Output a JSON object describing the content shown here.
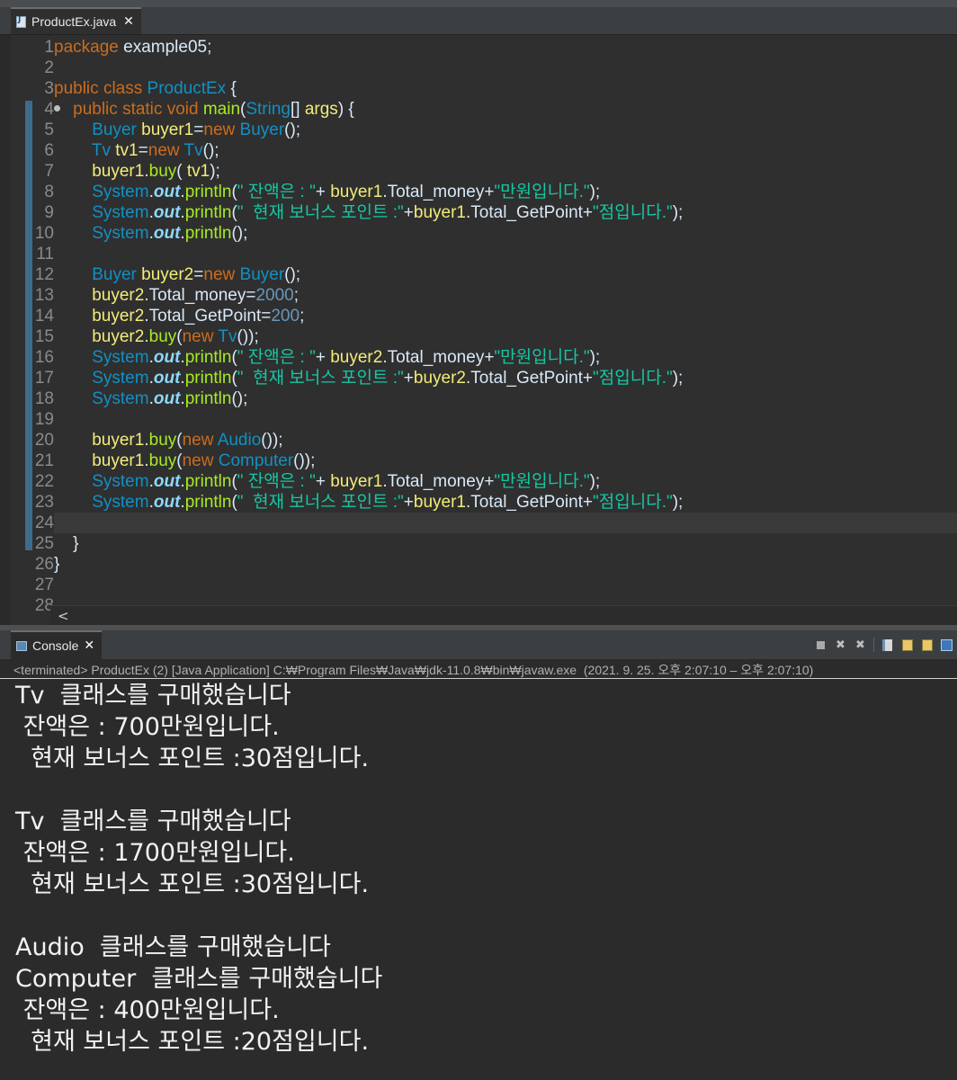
{
  "editor": {
    "tab_title": "ProductEx.java",
    "tab_close": "✕",
    "line_numbers": [
      "1",
      "2",
      "3",
      "4",
      "5",
      "6",
      "7",
      "8",
      "9",
      "10",
      "11",
      "12",
      "13",
      "14",
      "15",
      "16",
      "17",
      "18",
      "19",
      "20",
      "21",
      "22",
      "23",
      "24",
      "25",
      "26",
      "27",
      "28"
    ],
    "lines": [
      "package example05;",
      "",
      "public class ProductEx {",
      "    public static void main(String[] args) {",
      "        Buyer buyer1=new Buyer();",
      "        Tv tv1=new Tv();",
      "        buyer1.buy( tv1);",
      "        System.out.println(\" 잔액은 : \"+ buyer1.Total_money+\"만원입니다.\");",
      "        System.out.println(\"  현재 보너스 포인트 :\"+buyer1.Total_GetPoint+\"점입니다.\");",
      "        System.out.println();",
      "",
      "        Buyer buyer2=new Buyer();",
      "        buyer2.Total_money=2000;",
      "        buyer2.Total_GetPoint=200;",
      "        buyer2.buy(new Tv());",
      "        System.out.println(\" 잔액은 : \"+ buyer2.Total_money+\"만원입니다.\");",
      "        System.out.println(\"  현재 보너스 포인트 :\"+buyer2.Total_GetPoint+\"점입니다.\");",
      "        System.out.println();",
      "",
      "        buyer1.buy(new Audio());",
      "        buyer1.buy(new Computer());",
      "        System.out.println(\" 잔액은 : \"+ buyer1.Total_money+\"만원입니다.\");",
      "        System.out.println(\"  현재 보너스 포인트 :\"+buyer1.Total_GetPoint+\"점입니다.\");",
      "",
      "    }",
      "}",
      "",
      ""
    ],
    "scroll_left": "<"
  },
  "console": {
    "tab_title": "Console",
    "tab_close": "✕",
    "status": "<terminated> ProductEx (2) [Java Application] C:₩Program Files₩Java₩jdk-11.0.8₩bin₩javaw.exe  (2021. 9. 25. 오후 2:07:10 – 오후 2:07:10)",
    "output": [
      "Tv  클래스를 구매했습니다",
      " 잔액은 : 700만원입니다.",
      "  현재 보너스 포인트 :30점입니다.",
      "",
      "Tv  클래스를 구매했습니다",
      " 잔액은 : 1700만원입니다.",
      "  현재 보너스 포인트 :30점입니다.",
      "",
      "Audio  클래스를 구매했습니다",
      "Computer  클래스를 구매했습니다",
      " 잔액은 : 400만원입니다.",
      "  현재 보너스 포인트 :20점입니다."
    ],
    "toolbar_icons": [
      "stop-icon",
      "remove-launch-icon",
      "remove-all-icon",
      "clear-console-icon",
      "scroll-lock-icon",
      "word-wrap-icon",
      "pin-console-icon"
    ]
  },
  "colors": {
    "keyword": "#cc6c1d",
    "class_name": "#1290c3",
    "variable": "#f3ec79",
    "method": "#a7ec21",
    "string": "#17c6a3",
    "static_field": "#8dd9fd",
    "number": "#6897bb",
    "editor_bg": "#2f2f2f",
    "console_bg": "#2b2b2b"
  }
}
